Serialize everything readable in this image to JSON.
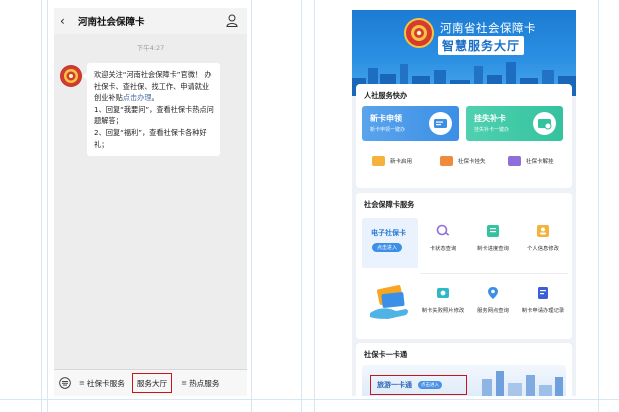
{
  "chat": {
    "title": "河南社会保障卡",
    "time": "下午4:27",
    "message": {
      "line1_pre": "欢迎关注“河南社会保障卡”官微！ 办社保卡、查社保、找工作、申请就业创业补贴",
      "line1_link": "点击办理",
      "line1_post": "。",
      "line2": "1、回复“我要问”，查看社保卡热点问题解答；",
      "line3": "2、回复“福利”，查看社保卡各种好礼；"
    },
    "menu": {
      "item1": "社保卡服务",
      "item2": "服务大厅",
      "item3": "热点服务"
    }
  },
  "hall": {
    "banner_title": "河南省社会保障卡",
    "banner_subtitle": "智慧服务大厅",
    "section1": {
      "title": "人社服务快办",
      "tile1_title": "新卡申领",
      "tile1_sub": "新卡申领一键办",
      "tile2_title": "挂失补卡",
      "tile2_sub": "挂失补卡一键办",
      "quick1": "新卡启用",
      "quick2": "社保卡挂失",
      "quick3": "社保卡解挂"
    },
    "section2": {
      "title": "社会保障卡服务",
      "promo_title": "电子社保卡",
      "promo_button": "点击进入",
      "svc1": "卡状态查询",
      "svc2": "制卡进度查询",
      "svc3": "个人信息修改",
      "svc4": "制卡失败照片修改",
      "svc5": "服务网点查询",
      "svc6": "制卡申请办理记录"
    },
    "section3": {
      "title": "社保卡一卡通",
      "banner_text": "旅游一卡通",
      "banner_button": "点击进入"
    }
  },
  "colors": {
    "accent_blue": "#2a8fe2",
    "highlight_red": "#c8141e",
    "tile_green": "#35c29e"
  }
}
